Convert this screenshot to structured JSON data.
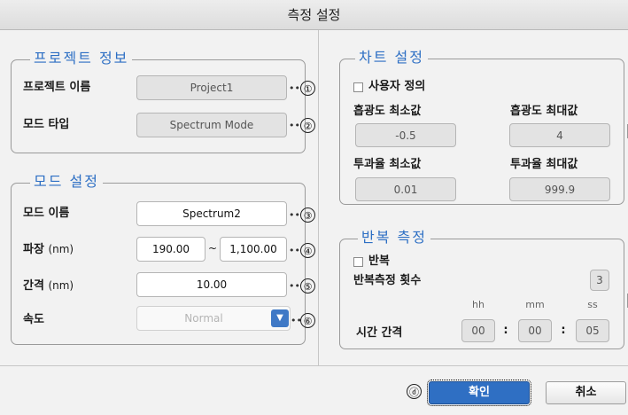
{
  "window": {
    "title": "측정 설정"
  },
  "project_info": {
    "legend": "프로젝트 정보",
    "name_label": "프로젝트 이름",
    "name_value": "Project1",
    "mode_type_label": "모드 타입",
    "mode_type_value": "Spectrum Mode",
    "callout_1": "①",
    "callout_2": "②"
  },
  "mode_settings": {
    "legend": "모드 설정",
    "mode_name_label": "모드 이름",
    "mode_name_value": "Spectrum2",
    "wavelength_label": "파장",
    "wavelength_unit": "(nm)",
    "wavelength_from": "190.00",
    "wavelength_sep": "~",
    "wavelength_to": "1,100.00",
    "interval_label": "간격",
    "interval_unit": "(nm)",
    "interval_value": "10.00",
    "speed_label": "속도",
    "speed_value": "Normal",
    "callout_3": "③",
    "callout_4": "④",
    "callout_5": "⑤",
    "callout_6": "⑥"
  },
  "chart_settings": {
    "legend": "차트 설정",
    "custom_label": "사용자 정의",
    "abs_min_label": "흡광도 최소값",
    "abs_max_label": "흡광도 최대값",
    "abs_min_value": "-0.5",
    "abs_max_value": "4",
    "trans_min_label": "투과율 최소값",
    "trans_max_label": "투과율 최대값",
    "trans_min_value": "0.01",
    "trans_max_value": "999.9"
  },
  "repeat_measure": {
    "legend": "반복 측정",
    "repeat_label": "반복",
    "count_label": "반복측정 횟수",
    "count_value": "3",
    "hh_label": "hh",
    "mm_label": "mm",
    "ss_label": "ss",
    "interval_label": "시간 간격",
    "hh_value": "00",
    "mm_value": "00",
    "ss_value": "05",
    "colon": ":"
  },
  "footer": {
    "callout_d": "ⓓ",
    "ok_label": "확인",
    "cancel_label": "취소"
  },
  "dropdown_icon": "chevron-down"
}
